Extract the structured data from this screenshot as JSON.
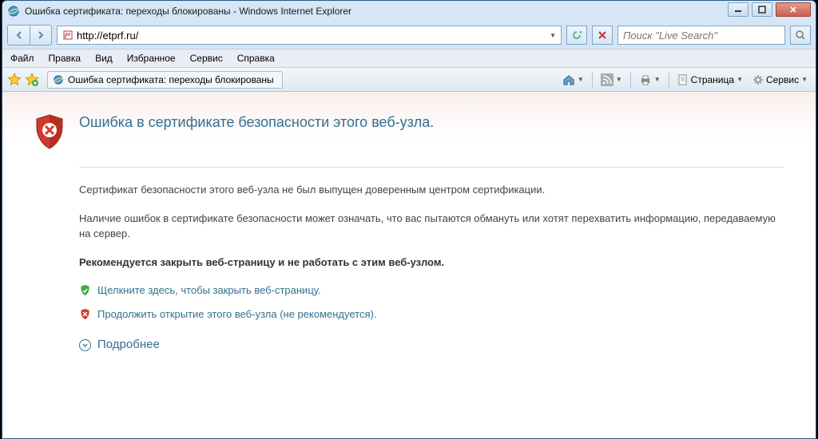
{
  "window": {
    "title": "Ошибка сертификата: переходы блокированы - Windows Internet Explorer"
  },
  "address": {
    "url": "http://etprf.ru/"
  },
  "search": {
    "placeholder": "Поиск \"Live Search\""
  },
  "menu": {
    "file": "Файл",
    "edit": "Правка",
    "view": "Вид",
    "favorites": "Избранное",
    "tools": "Сервис",
    "help": "Справка"
  },
  "tab": {
    "title": "Ошибка сертификата: переходы блокированы"
  },
  "cmd": {
    "page": "Страница",
    "tools": "Сервис"
  },
  "cert": {
    "heading": "Ошибка в сертификате безопасности этого веб-узла.",
    "p1": "Сертификат безопасности этого веб-узла не был выпущен доверенным центром сертификации.",
    "p2": "Наличие ошибок в сертификате безопасности может означать, что вас пытаются обмануть или хотят перехватить информацию, передаваемую на сервер.",
    "rec": "Рекомендуется закрыть веб-страницу и не работать с этим веб-узлом.",
    "close": "Щелкните здесь, чтобы закрыть веб-страницу.",
    "continue": "Продолжить открытие этого веб-узла (не рекомендуется).",
    "more": "Подробнее"
  }
}
